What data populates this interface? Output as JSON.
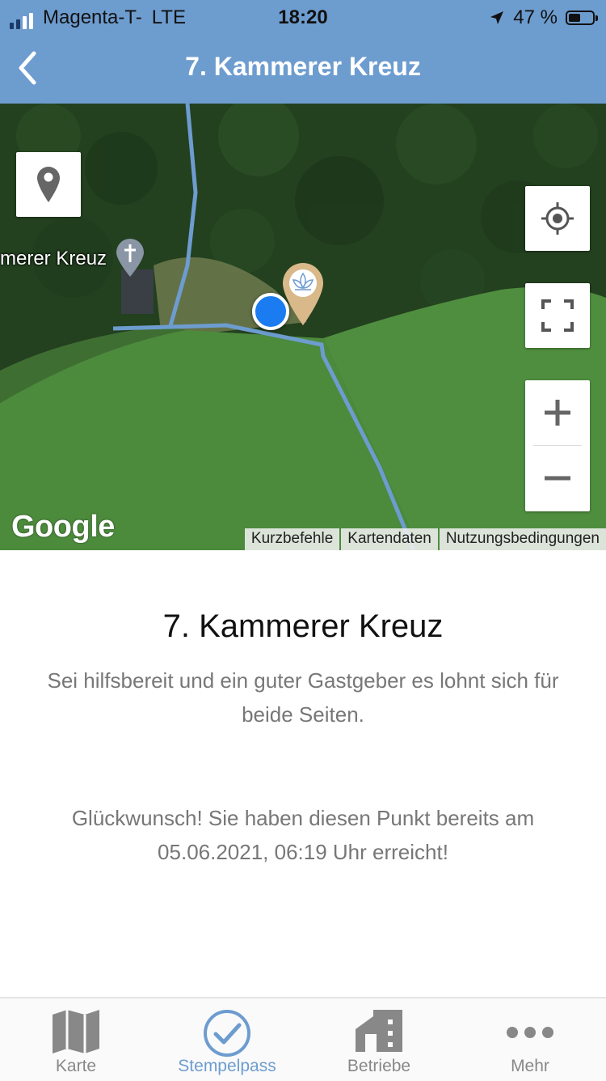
{
  "status_bar": {
    "carrier": "Magenta-T-",
    "network": "LTE",
    "time": "18:20",
    "battery": "47 %"
  },
  "nav": {
    "title": "7. Kammerer Kreuz"
  },
  "map": {
    "poi_label": "merer Kreuz",
    "logo": "Google",
    "attribution": {
      "shortcuts": "Kurzbefehle",
      "map_data": "Kartendaten",
      "terms": "Nutzungsbedingungen"
    },
    "controls": {
      "layers_icon": "location-pin-icon",
      "locate_icon": "crosshair-icon",
      "fullscreen_icon": "fullscreen-icon",
      "zoom_in": "+",
      "zoom_out": "−"
    }
  },
  "content": {
    "title": "7. Kammerer Kreuz",
    "description": "Sei hilfsbereit und ein guter Gastgeber es lohnt sich für beide Seiten.",
    "congrats": "Glückwunsch! Sie haben diesen Punkt bereits am 05.06.2021, 06:19 Uhr erreicht!"
  },
  "tabs": [
    {
      "label": "Karte",
      "icon": "map-icon",
      "active": false
    },
    {
      "label": "Stempelpass",
      "icon": "checkmark-circle-icon",
      "active": true
    },
    {
      "label": "Betriebe",
      "icon": "building-icon",
      "active": false
    },
    {
      "label": "Mehr",
      "icon": "more-dots-icon",
      "active": false
    }
  ],
  "colors": {
    "header": "#6d9ccf",
    "route": "#6d9ccf",
    "user_dot": "#1a7cf0",
    "marker": "#d9b98a"
  }
}
